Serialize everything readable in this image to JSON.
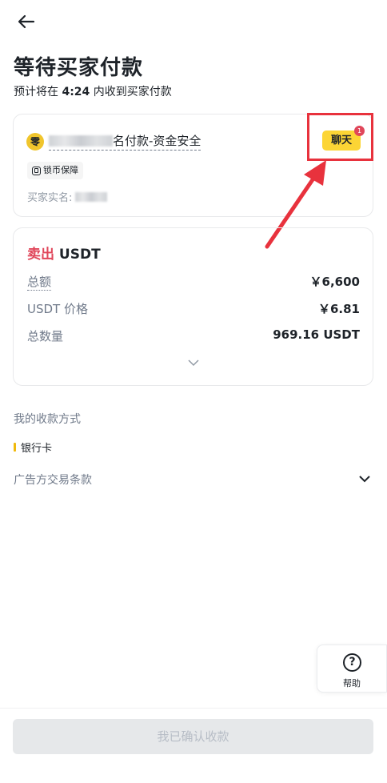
{
  "header": {
    "back_icon": "arrow-left-icon",
    "title": "等待买家付款",
    "subtitle_prefix": "预计将在 ",
    "subtitle_time": "4:24",
    "subtitle_suffix": " 内收到买家付款"
  },
  "buyer_card": {
    "avatar_char": "零",
    "buyer_suffix": "名付款-资金安全",
    "badge_label": "锁币保障",
    "badge_icon": "lock-shield-icon",
    "real_name_label": "买家实名:",
    "chat_label": "聊天",
    "chat_unread": "1"
  },
  "order_card": {
    "side": "卖出",
    "asset": "USDT",
    "rows": [
      {
        "label": "总额",
        "value": "￥6,600"
      },
      {
        "label": "USDT 价格",
        "value": "￥6.81"
      },
      {
        "label": "总数量",
        "value": "969.16 USDT"
      }
    ]
  },
  "payment": {
    "section_label": "我的收款方式",
    "method": "银行卡"
  },
  "terms": {
    "label": "广告方交易条款"
  },
  "help": {
    "label": "帮助",
    "icon": "question-circle-icon"
  },
  "footer": {
    "confirm_label": "我已确认收款"
  },
  "colors": {
    "accent_yellow": "#fcd535",
    "sell_red": "#e0465a",
    "annotation_red": "#e8323d"
  }
}
